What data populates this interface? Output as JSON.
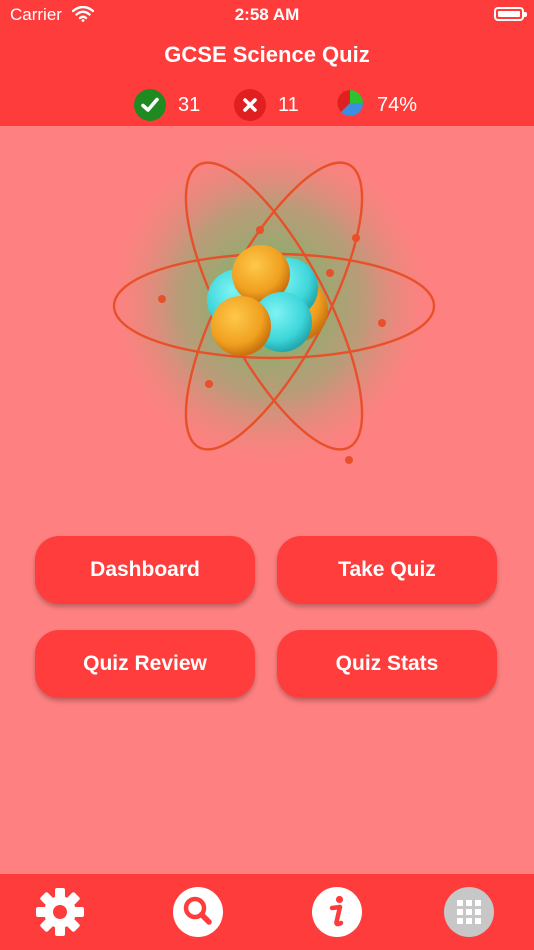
{
  "status_bar": {
    "carrier": "Carrier",
    "time": "2:58 AM",
    "icons": [
      "wifi-icon",
      "battery-icon"
    ]
  },
  "header": {
    "title": "GCSE Science Quiz",
    "correct_count": "31",
    "wrong_count": "11",
    "percentage": "74%"
  },
  "hero": {
    "icon": "atom-icon"
  },
  "buttons": {
    "dashboard": "Dashboard",
    "take_quiz": "Take Quiz",
    "quiz_review": "Quiz Review",
    "quiz_stats": "Quiz Stats"
  },
  "tabbar": {
    "icons": [
      "gear-icon",
      "search-icon",
      "info-icon",
      "grid-icon"
    ]
  },
  "colors": {
    "accent": "#ff3c3c",
    "background": "#ff8080",
    "correct": "#1f8a1f",
    "wrong": "#e02020"
  }
}
